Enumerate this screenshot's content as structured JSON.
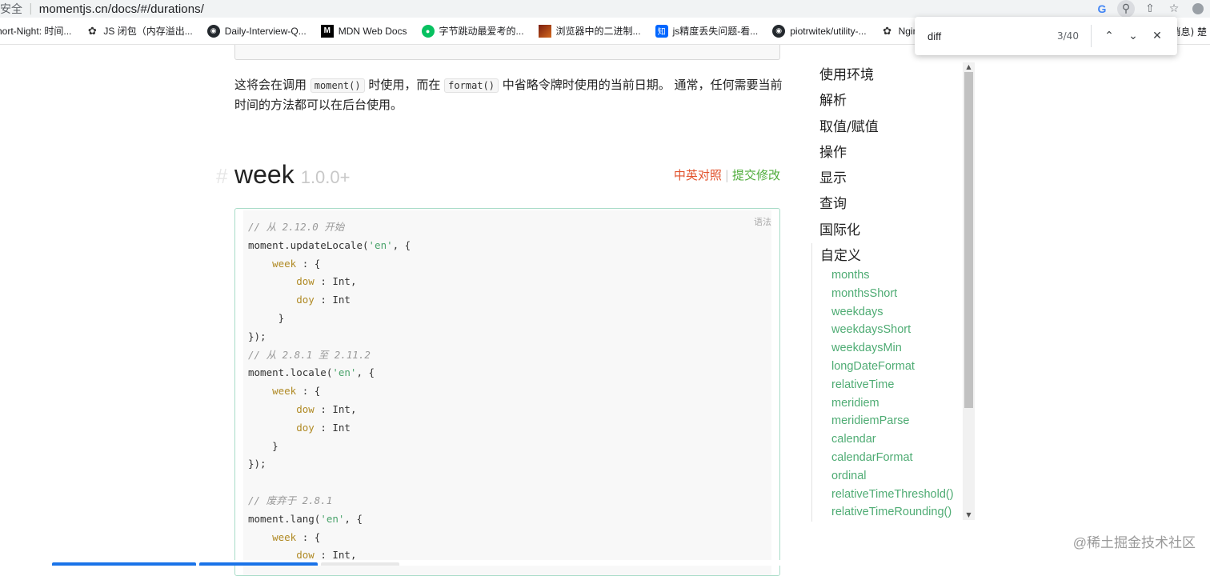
{
  "address_bar": {
    "security_label": "安全",
    "url": "momentjs.cn/docs/#/durations/"
  },
  "bookmarks": [
    {
      "label": "hort-Night: 时间...",
      "icon": "none"
    },
    {
      "label": "JS 闭包（内存溢出...",
      "icon": "scribble-icon"
    },
    {
      "label": "Daily-Interview-Q...",
      "icon": "github-icon"
    },
    {
      "label": "MDN Web Docs",
      "icon": "mdn-icon"
    },
    {
      "label": "字节跳动最爱考的...",
      "icon": "wechat-icon"
    },
    {
      "label": "浏览器中的二进制...",
      "icon": "image-icon"
    },
    {
      "label": "js精度丢失问题-看...",
      "icon": "zhihu-icon"
    },
    {
      "label": "piotrwitek/utility-...",
      "icon": "github-icon"
    },
    {
      "label": "Nginx",
      "icon": "scribble-icon"
    }
  ],
  "bookmarks_right_text": "消息) 楚",
  "find_bar": {
    "query": "diff",
    "count": "3/40"
  },
  "main": {
    "paragraph_before_code1": "这将会在调用",
    "inline_code1": "moment()",
    "paragraph_mid": "时使用，而在",
    "inline_code2": "format()",
    "paragraph_after": "中省略令牌时使用的当前日期。 通常，任何需要当前时间的方法都可以在后台使用。",
    "section": {
      "hash": "#",
      "title": "week",
      "version": "1.0.0+",
      "link_translate": "中英对照",
      "link_separator": "|",
      "link_edit": "提交修改"
    },
    "code_lang_label": "语法",
    "code_lines": [
      "// 从 2.12.0 开始",
      "moment.updateLocale('en', {",
      "    week : {",
      "        dow : Int,",
      "        doy : Int",
      "     }",
      "});",
      "// 从 2.8.1 至 2.11.2",
      "moment.locale('en', {",
      "    week : {",
      "        dow : Int,",
      "        doy : Int",
      "    }",
      "});",
      "",
      "// 废弃于 2.8.1",
      "moment.lang('en', {",
      "    week : {",
      "        dow : Int,"
    ]
  },
  "sidebar": {
    "top_items": [
      "使用环境",
      "解析",
      "取值/赋值",
      "操作",
      "显示",
      "查询",
      "国际化"
    ],
    "active_section": "自定义",
    "sub_items": [
      "months",
      "monthsShort",
      "weekdays",
      "weekdaysShort",
      "weekdaysMin",
      "longDateFormat",
      "relativeTime",
      "meridiem",
      "meridiemParse",
      "calendar",
      "calendarFormat",
      "ordinal",
      "relativeTimeThreshold()",
      "relativeTimeRounding()"
    ]
  },
  "watermark": "@稀土掘金技术社区",
  "colors": {
    "link_red": "#e2532d",
    "link_green": "#4fac3b",
    "sidebar_link": "#4fac74",
    "code_border": "#a9dcc8"
  }
}
